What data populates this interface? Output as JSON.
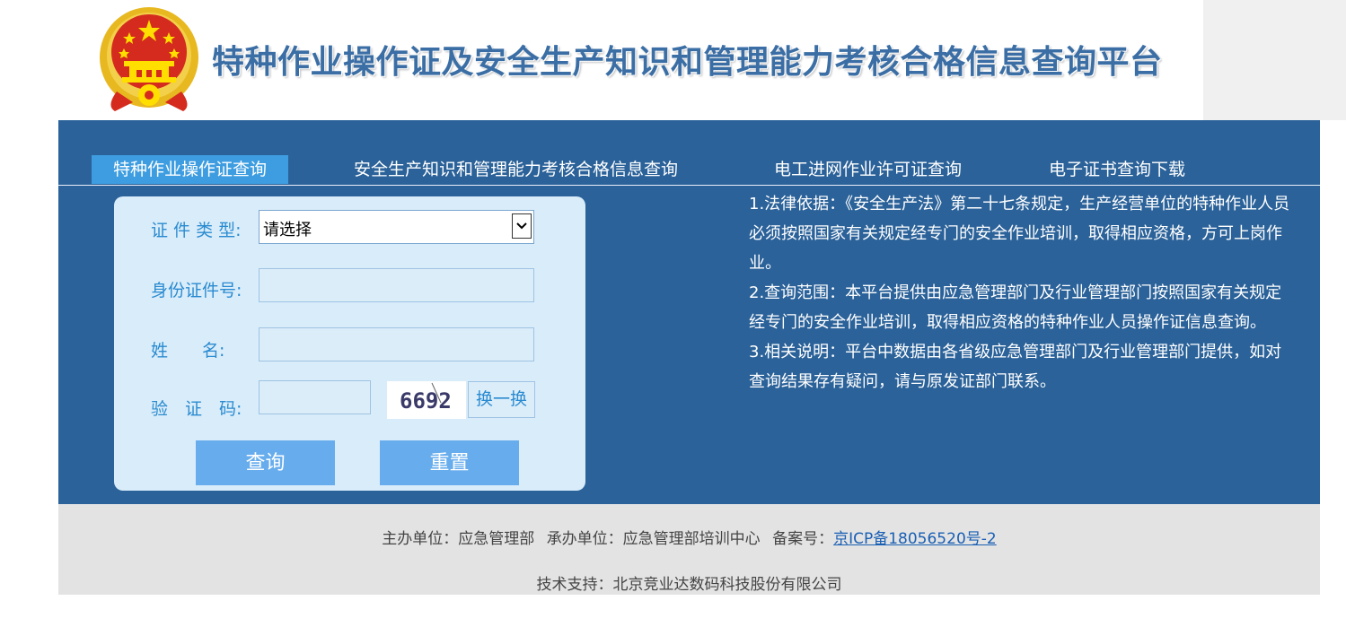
{
  "header": {
    "emblem_icon": "national-emblem-icon",
    "title": "特种作业操作证及安全生产知识和管理能力考核合格信息查询平台"
  },
  "nav": {
    "tabs": [
      {
        "label": "特种作业操作证查询",
        "active": true
      },
      {
        "label": "安全生产知识和管理能力考核合格信息查询",
        "active": false
      },
      {
        "label": "电工进网作业许可证查询",
        "active": false
      },
      {
        "label": "电子证书查询下载",
        "active": false
      }
    ]
  },
  "form": {
    "cert_type_label": "证 件 类 型:",
    "cert_type_value": "请选择",
    "id_label": "身份证件号:",
    "id_value": "",
    "name_label": "姓　　名:",
    "name_value": "",
    "captcha_label": "验　证　码:",
    "captcha_value": "",
    "captcha_text": "6692",
    "swap_label": "换一换",
    "query_button": "查询",
    "reset_button": "重置"
  },
  "notes": [
    "1.法律依据：《安全生产法》第二十七条规定，生产经营单位的特种作业人员必须按照国家有关规定经专门的安全作业培训，取得相应资格，方可上岗作业。",
    "2.查询范围：本平台提供由应急管理部门及行业管理部门按照国家有关规定经专门的安全作业培训，取得相应资格的特种作业人员操作证信息查询。",
    "3.相关说明：平台中数据由各省级应急管理部门及行业管理部门提供，如对查询结果存有疑问，请与原发证部门联系。"
  ],
  "footer": {
    "host": "主办单位：应急管理部",
    "organizer": "承办单位：应急管理部培训中心",
    "icp_label": "备案号：",
    "icp_link": "京ICP备18056520号-2",
    "tech_support": "技术支持：北京竞业达数码科技股份有限公司"
  },
  "colors": {
    "panel_blue": "#2b6299",
    "active_tab": "#3d9de0",
    "button_blue": "#67aded",
    "label_blue": "#2a8bd0",
    "card_bg": "#d9ecfa",
    "footer_bg": "#e3e3e3"
  }
}
